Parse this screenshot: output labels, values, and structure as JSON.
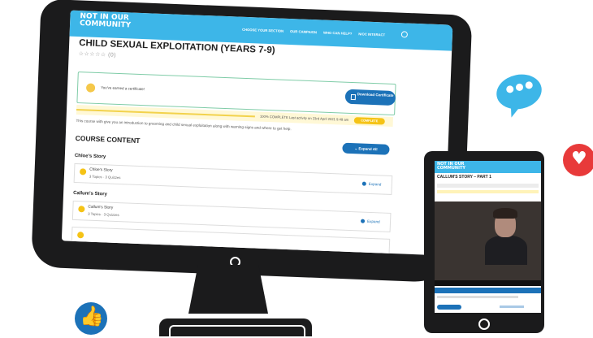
{
  "site": {
    "logo": "NOT IN OUR COMMUNITY",
    "nav": [
      "CHOOSE YOUR SECTION",
      "OUR CAMPAIGN",
      "WHO CAN HELP?",
      "NIOC INTERACT"
    ]
  },
  "course": {
    "title": "CHILD SEXUAL EXPLOITATION (YEARS 7-9)",
    "stars": "☆☆☆☆☆",
    "rating_count": "(0)",
    "certificate_text": "You've earned a certificate!",
    "download_label": "Download Certificate",
    "progress_text": "100% COMPLETE  Last activity on 23rd April 2021 9:48 am",
    "complete_badge": "COMPLETE",
    "description": "This course with give you an introduction to grooming and child sexual exploitation along with warning signs and where to get help.",
    "content_heading": "COURSE CONTENT",
    "expand_all_label": "Expand All",
    "sections": [
      {
        "heading": "Chloe's Story",
        "lesson": "Chloe's Story",
        "meta": "3 Topics · 3 Quizzes",
        "expand": "Expand"
      },
      {
        "heading": "Callum's Story",
        "lesson": "Callum's Story",
        "meta": "3 Topics · 3 Quizzes",
        "expand": "Expand"
      }
    ]
  },
  "tablet": {
    "logo": "NOT IN OUR COMMUNITY",
    "title": "CALLUM'S STORY – PART 1"
  },
  "colors": {
    "brand_blue": "#3db6e8",
    "button_blue": "#1c72b8",
    "accent_yellow": "#f5c316",
    "heart_red": "#e83a3a"
  }
}
